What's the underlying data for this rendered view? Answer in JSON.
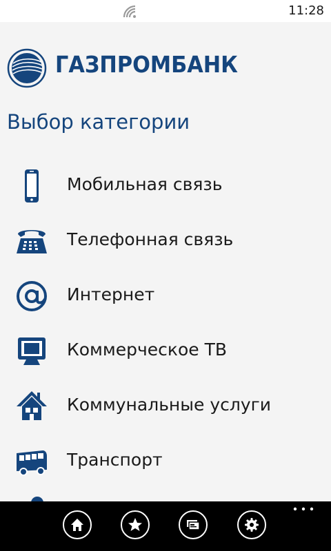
{
  "status_bar": {
    "time": "11:28",
    "signal_icon": "wifi-icon"
  },
  "header": {
    "logo_text": "ГАЗПРОМБАНК",
    "logo_icon": "gazprombank-logo-icon"
  },
  "page": {
    "title": "Выбор категории"
  },
  "categories": [
    {
      "label": "Мобильная связь",
      "icon": "mobile-phone-icon"
    },
    {
      "label": "Телефонная связь",
      "icon": "desk-phone-icon"
    },
    {
      "label": "Интернет",
      "icon": "at-sign-icon"
    },
    {
      "label": "Коммерческое ТВ",
      "icon": "tv-icon"
    },
    {
      "label": "Коммунальные услуги",
      "icon": "house-icon"
    },
    {
      "label": "Транспорт",
      "icon": "bus-icon"
    }
  ],
  "app_bar": {
    "buttons": [
      {
        "icon": "home-icon"
      },
      {
        "icon": "star-icon"
      },
      {
        "icon": "wallet-icon"
      },
      {
        "icon": "gear-icon"
      }
    ],
    "more_icon": "more-dots-icon"
  },
  "colors": {
    "brand": "#15457d",
    "background": "#f4f4f4",
    "app_bar": "#000000",
    "text": "#1a1a1a"
  }
}
